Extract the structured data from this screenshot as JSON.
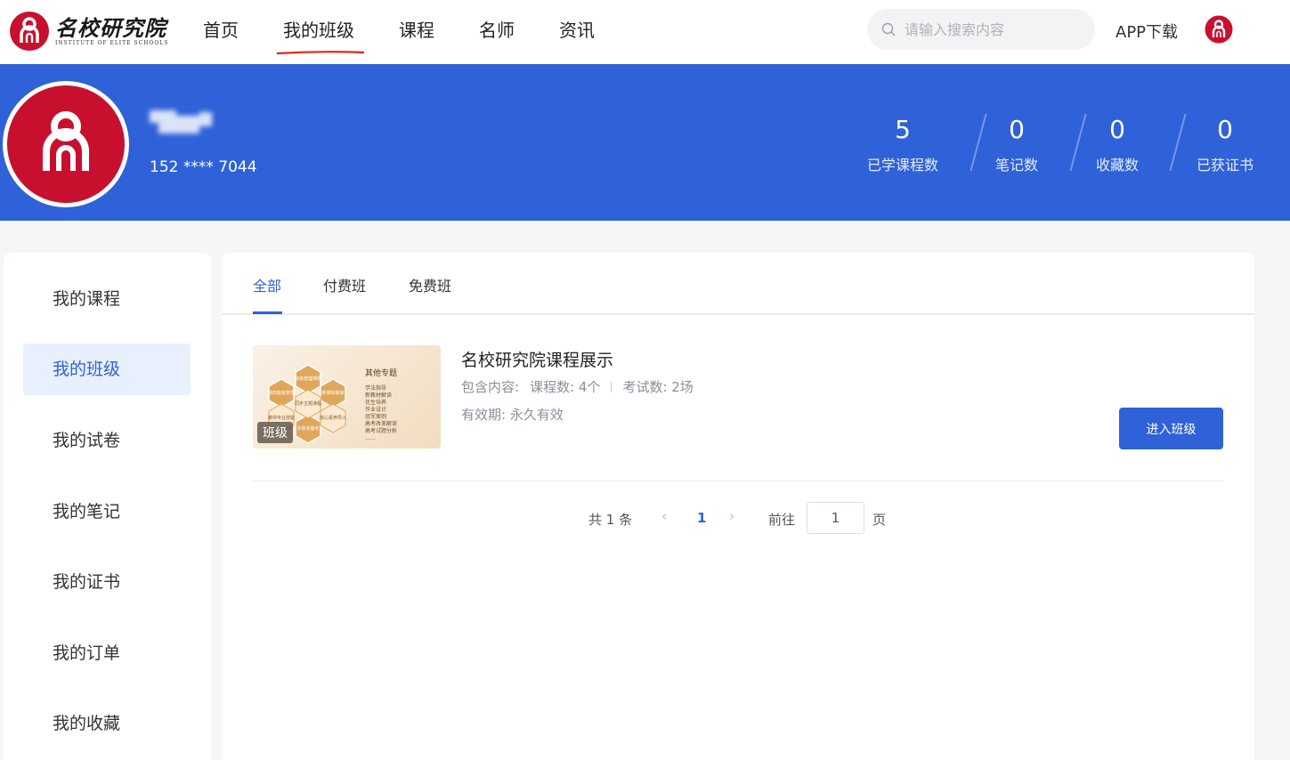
{
  "header": {
    "logo_cn": "名校研究院",
    "logo_en": "INSTITUTE OF ELITE SCHOOLS",
    "nav": [
      {
        "label": "首页"
      },
      {
        "label": "我的班级"
      },
      {
        "label": "课程"
      },
      {
        "label": "名师"
      },
      {
        "label": "资讯"
      }
    ],
    "search_placeholder": "请输入搜索内容",
    "app_download": "APP下载"
  },
  "profile": {
    "phone": "152 **** 7044",
    "stats": [
      {
        "value": "5",
        "label": "已学课程数"
      },
      {
        "value": "0",
        "label": "笔记数"
      },
      {
        "value": "0",
        "label": "收藏数"
      },
      {
        "value": "0",
        "label": "已获证书"
      }
    ]
  },
  "sidebar": {
    "items": [
      {
        "label": "我的课程"
      },
      {
        "label": "我的班级"
      },
      {
        "label": "我的试卷"
      },
      {
        "label": "我的笔记"
      },
      {
        "label": "我的证书"
      },
      {
        "label": "我的订单"
      },
      {
        "label": "我的收藏"
      }
    ]
  },
  "tabs": [
    {
      "label": "全部"
    },
    {
      "label": "付费班"
    },
    {
      "label": "免费班"
    }
  ],
  "course": {
    "badge": "班级",
    "thumb_heading": "其他专题",
    "thumb_list": [
      "学法指导",
      "新教材解读",
      "优生培养",
      "作业设计",
      "冠军案例",
      "高考改革解读",
      "高考试题分析",
      "……"
    ],
    "thumb_hex": [
      "班级管理课程",
      "我的班级管理",
      "新课标解读",
      "教师专业技能",
      "同步主题课程",
      "核心素养导入",
      "中高考备考"
    ],
    "title": "名校研究院课程展示",
    "meta_prefix": "包含内容:",
    "meta_courses": "课程数: 4个",
    "meta_exams": "考试数: 2场",
    "validity": "有效期: 永久有效",
    "enter_button": "进入班级"
  },
  "pagination": {
    "total": "共 1 条",
    "current": "1",
    "goto_label": "前往",
    "goto_value": "1",
    "page_suffix": "页"
  },
  "colors": {
    "primary": "#2f62d8",
    "brand_red": "#c8102e",
    "banner": "#2f62d8"
  }
}
